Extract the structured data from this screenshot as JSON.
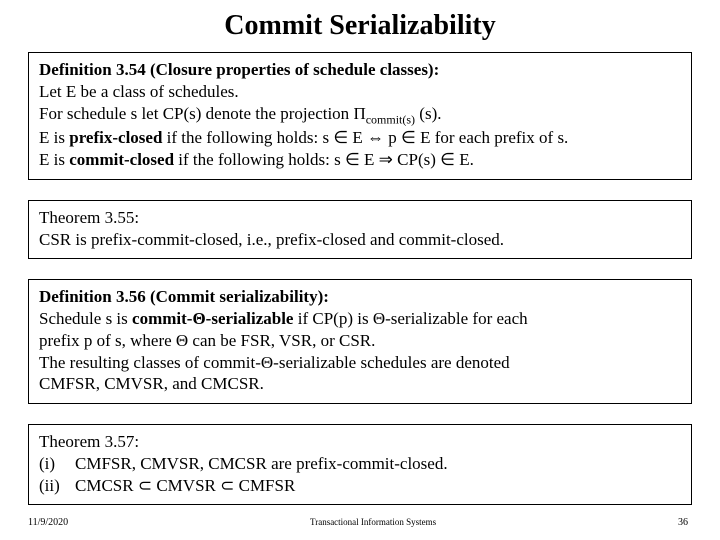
{
  "title": "Commit Serializability",
  "box1": {
    "line1_prefix": "Definition 3.54 (Closure properties of schedule classes):",
    "line2": "Let E be a class of schedules.",
    "line3_a": "For schedule s let CP(s) denote the projection ",
    "line3_pi": "Π",
    "line3_sub": "commit(s)",
    "line3_b": " (s).",
    "line4_a": "E is ",
    "line4_bold": "prefix-closed",
    "line4_b": " if the following holds: s ∈ E ⇔  p ∈ E for each prefix of s.",
    "line5_a": "E is ",
    "line5_bold": "commit-closed",
    "line5_b": " if the following holds: s ∈ E ⇒ CP(s) ∈ E."
  },
  "box2": {
    "line1": "Theorem 3.55:",
    "line2": "CSR is prefix-commit-closed, i.e., prefix-closed and commit-closed."
  },
  "box3": {
    "line1": "Definition 3.56 (Commit serializability):",
    "line2_a": "Schedule s is ",
    "line2_bold": "commit-Θ-serializable",
    "line2_b": " if CP(p) is Θ-serializable for each",
    "line3": "prefix p of s, where Θ can be FSR, VSR, or CSR.",
    "line4": "The resulting classes of commit-Θ-serializable schedules are denoted",
    "line5": "CMFSR, CMVSR, and CMCSR."
  },
  "box4": {
    "line1": "Theorem 3.57:",
    "item1_lbl": "(i)",
    "item1_txt": "CMFSR, CMVSR, CMCSR are prefix-commit-closed.",
    "item2_lbl": "(ii)",
    "item2_txt": "CMCSR ⊂ CMVSR ⊂ CMFSR"
  },
  "footer": {
    "left": "11/9/2020",
    "center": "Transactional Information Systems",
    "right": "36"
  }
}
